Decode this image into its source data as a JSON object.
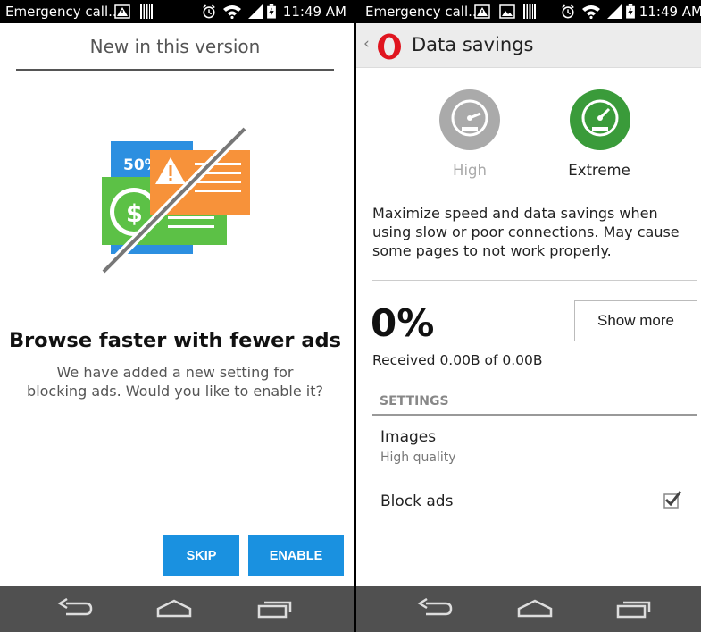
{
  "left": {
    "status": {
      "carrier": "Emergency call...",
      "time": "11:49 AM"
    },
    "title": "New in this version",
    "illustration": {
      "discount_text": "50%",
      "currency_symbol": "$"
    },
    "heading": "Browse faster with fewer ads",
    "description": "We have added a new setting for blocking ads. Would you like to enable it?",
    "buttons": {
      "skip": "SKIP",
      "enable": "ENABLE"
    },
    "colors": {
      "accent": "#1a91e0"
    }
  },
  "right": {
    "status": {
      "carrier": "Emergency call...",
      "time": "11:49 AM"
    },
    "header": {
      "title": "Data savings",
      "back_icon": "back-chevron-icon",
      "logo": "opera-logo"
    },
    "modes": [
      {
        "label": "High",
        "selected": false,
        "color": "#aaaaaa"
      },
      {
        "label": "Extreme",
        "selected": true,
        "color": "#3a9b3a"
      }
    ],
    "description": "Maximize speed and data savings when using slow or poor connections. May cause some pages to not work properly.",
    "percent": "0%",
    "received": "Received 0.00B of 0.00B",
    "show_more": "Show more",
    "section_header": "SETTINGS",
    "settings": [
      {
        "label": "Images",
        "sublabel": "High quality"
      },
      {
        "label": "Block ads",
        "checked": true
      }
    ]
  }
}
